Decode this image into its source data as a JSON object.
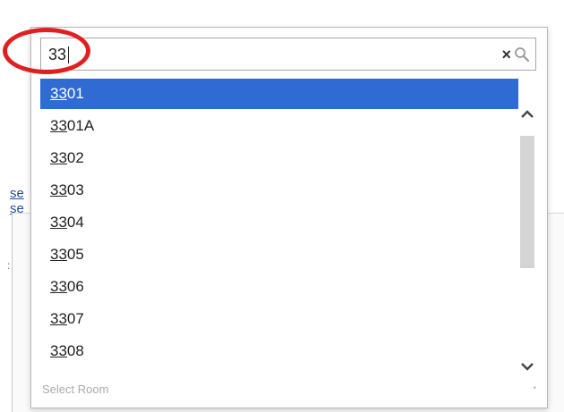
{
  "background": {
    "link_fragments": [
      "se",
      "se"
    ],
    "edge_mark": ":"
  },
  "search": {
    "value": "33",
    "clear_symbol": "×"
  },
  "options": [
    {
      "match": "33",
      "rest": "01"
    },
    {
      "match": "33",
      "rest": "01A"
    },
    {
      "match": "33",
      "rest": "02"
    },
    {
      "match": "33",
      "rest": "03"
    },
    {
      "match": "33",
      "rest": "04"
    },
    {
      "match": "33",
      "rest": "05"
    },
    {
      "match": "33",
      "rest": "06"
    },
    {
      "match": "33",
      "rest": "07"
    },
    {
      "match": "33",
      "rest": "08"
    }
  ],
  "selected_index": 0,
  "footer": {
    "placeholder": "Select Room",
    "dot": "•"
  },
  "colors": {
    "selected_bg": "#2f6bd3",
    "annotation": "#e02020"
  },
  "icons": {
    "clear": "close-icon",
    "search": "search-icon",
    "scroll_up": "chevron-up-icon",
    "scroll_down": "chevron-down-icon"
  }
}
